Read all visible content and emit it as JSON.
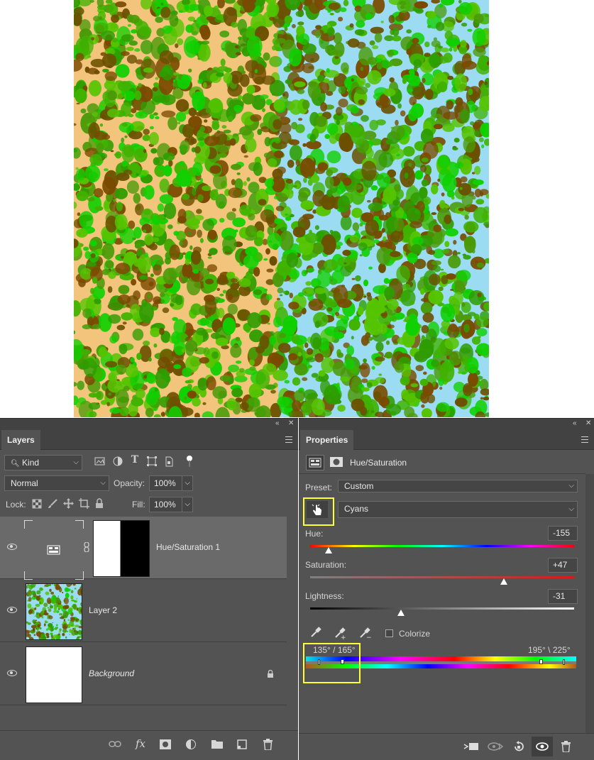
{
  "layers_panel": {
    "tab": "Layers",
    "filter": {
      "label": "Kind"
    },
    "blend_mode": "Normal",
    "opacity_label": "Opacity:",
    "opacity_value": "100%",
    "lock_label": "Lock:",
    "fill_label": "Fill:",
    "fill_value": "100%",
    "layers": [
      {
        "name": "Hue/Saturation 1",
        "selected": true
      },
      {
        "name": "Layer 2",
        "selected": false
      },
      {
        "name": "Background",
        "selected": false,
        "italic": true
      }
    ],
    "bottom_icons": [
      "link-icon",
      "fx-icon",
      "mask-icon",
      "adjustment-icon",
      "folder-icon",
      "new-layer-icon",
      "trash-icon"
    ],
    "fx_label": "fx"
  },
  "properties_panel": {
    "tab": "Properties",
    "adjustment_title": "Hue/Saturation",
    "preset_label": "Preset:",
    "preset_value": "Custom",
    "channel_value": "Cyans",
    "hue_label": "Hue:",
    "hue_value": "-155",
    "saturation_label": "Saturation:",
    "saturation_value": "+47",
    "lightness_label": "Lightness:",
    "lightness_value": "-31",
    "colorize_label": "Colorize",
    "range_left": "135° / 165°",
    "range_right": "195° \\ 225°",
    "slider_levels": {
      "hue": 0.069,
      "saturation": 0.735,
      "lightness": 0.345
    },
    "bottom_icons": [
      "clip-icon",
      "view-previous-icon",
      "reset-icon",
      "visibility-icon",
      "trash-icon"
    ]
  },
  "colors": {
    "panel_bg": "#535353",
    "selected_row": "#6a6a6a",
    "canvas_left": "#f2c47c",
    "canvas_right": "#9bdcf2",
    "highlight": "#ffff3a"
  }
}
